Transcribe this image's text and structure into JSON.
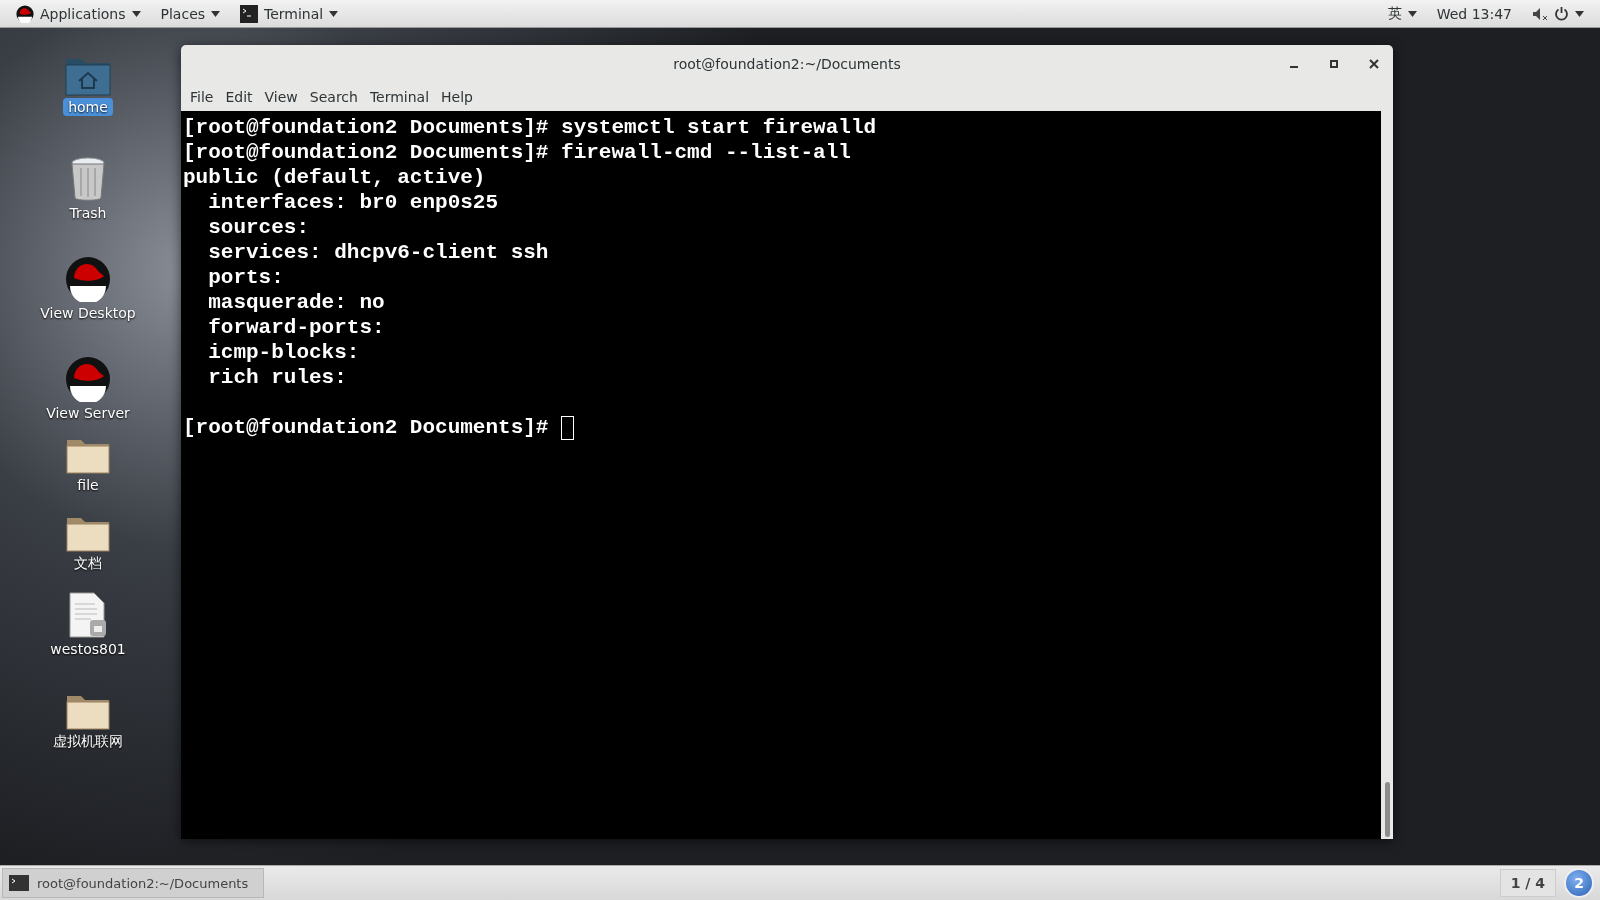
{
  "top_bar": {
    "applications": "Applications",
    "places": "Places",
    "running_app": "Terminal",
    "input_method": "英",
    "clock": "Wed 13:47"
  },
  "desktop_icons": [
    {
      "label": "home",
      "kind": "home",
      "selected": true
    },
    {
      "label": "Trash",
      "kind": "trash",
      "selected": false
    },
    {
      "label": "View Desktop",
      "kind": "hat",
      "selected": false
    },
    {
      "label": "View Server",
      "kind": "hat",
      "selected": false
    },
    {
      "label": "file",
      "kind": "folder",
      "selected": false
    },
    {
      "label": "文档",
      "kind": "folder",
      "selected": false
    },
    {
      "label": "westos801",
      "kind": "document",
      "selected": false
    },
    {
      "label": "虚拟机联网",
      "kind": "folder",
      "selected": false
    }
  ],
  "window": {
    "title": "root@foundation2:~/Documents",
    "menu": [
      "File",
      "Edit",
      "View",
      "Search",
      "Terminal",
      "Help"
    ],
    "terminal": {
      "lines": [
        "[root@foundation2 Documents]# systemctl start firewalld",
        "[root@foundation2 Documents]# firewall-cmd --list-all",
        "public (default, active)",
        "  interfaces: br0 enp0s25",
        "  sources: ",
        "  services: dhcpv6-client ssh",
        "  ports: ",
        "  masquerade: no",
        "  forward-ports: ",
        "  icmp-blocks: ",
        "  rich rules: "
      ],
      "prompt": "[root@foundation2 Documents]# ",
      "cursor": true
    }
  },
  "bottom_bar": {
    "task": "root@foundation2:~/Documents",
    "workspace": "1 / 4",
    "notifications": "2"
  }
}
